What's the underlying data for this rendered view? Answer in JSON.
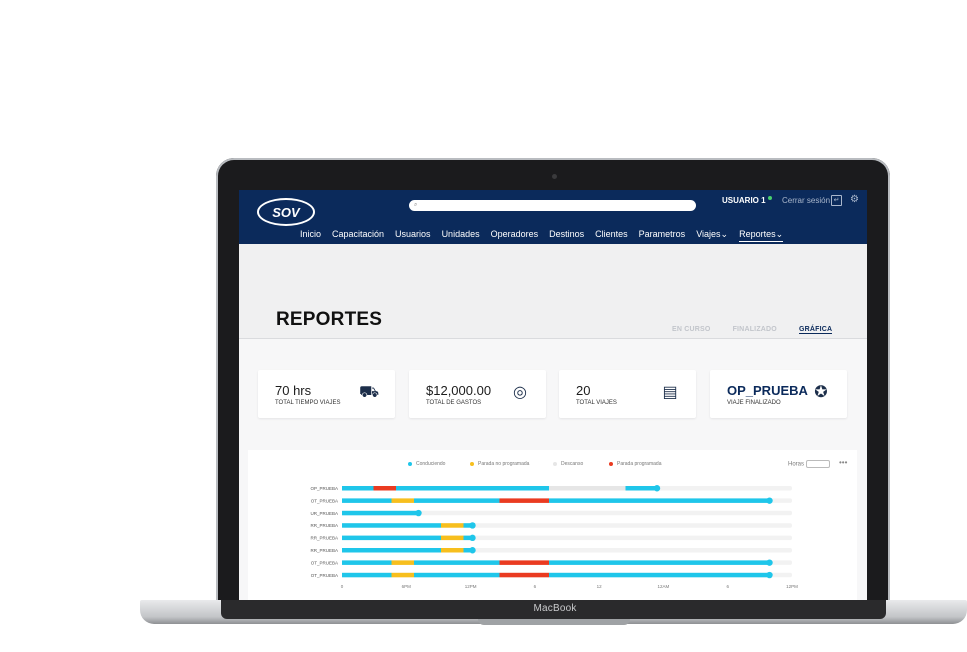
{
  "laptop": {
    "brand": "MacBook"
  },
  "header": {
    "logo": "SOV",
    "search_placeholder": "",
    "user": "USUARIO 1",
    "logout": "Cerrar sesión",
    "nav": [
      "Inicio",
      "Capacitación",
      "Usuarios",
      "Unidades",
      "Operadores",
      "Destinos",
      "Clientes",
      "Parametros",
      "Viajes⌄",
      "Reportes⌄"
    ],
    "active_nav": "Reportes"
  },
  "page": {
    "title": "REPORTES",
    "tabs": [
      "EN CURSO",
      "FINALIZADO",
      "GRÁFICA"
    ],
    "active_tab": "GRÁFICA"
  },
  "cards": [
    {
      "value": "70 hrs",
      "label": "TOTAL TIEMPO VIAJES",
      "icon": "truck-clock-icon"
    },
    {
      "value": "$12,000.00",
      "label": "TOTAL DE GASTOS",
      "icon": "coins-icon"
    },
    {
      "value": "20",
      "label": "TOTAL VIAJES",
      "icon": "document-list-icon"
    },
    {
      "value": "OP_PRUEBA",
      "label": "VIAJE FINALIZADO",
      "icon": "badge-icon"
    }
  ],
  "legend": [
    {
      "label": "Conduciendo",
      "color": "#1fc6ea"
    },
    {
      "label": "Parada no programada",
      "color": "#f7bf1e"
    },
    {
      "label": "Descanso",
      "color": "#e6e6e6"
    },
    {
      "label": "Parada programada",
      "color": "#ea3b21"
    }
  ],
  "controls": {
    "horas": "Horas",
    "more": "•••"
  },
  "chart_data": {
    "type": "timeline",
    "x_ticks": [
      "0",
      "6PM",
      "12PM",
      "6",
      "12",
      "12AM",
      "6",
      "12PM"
    ],
    "rows": [
      {
        "label": "OP_PRUEBA",
        "segments": [
          [
            "Conduciendo",
            0,
            0.7
          ],
          [
            "Parada programada",
            0.7,
            1.2
          ],
          [
            "Conduciendo",
            1.2,
            4.6
          ],
          [
            "Descanso",
            4.6,
            6.3
          ],
          [
            "Conduciendo",
            6.3,
            7.0
          ]
        ],
        "end": 7.0
      },
      {
        "label": "OT_PRUEBA",
        "segments": [
          [
            "Conduciendo",
            0,
            1.1
          ],
          [
            "Parada no programada",
            1.1,
            1.6
          ],
          [
            "Conduciendo",
            1.6,
            3.5
          ],
          [
            "Parada programada",
            3.5,
            4.6
          ],
          [
            "Conduciendo",
            4.6,
            9.5
          ]
        ],
        "end": 9.5
      },
      {
        "label": "UR_PRUEBA",
        "segments": [
          [
            "Conduciendo",
            0,
            1.7
          ]
        ],
        "end": 1.7
      },
      {
        "label": "RR_PRUEBA",
        "segments": [
          [
            "Conduciendo",
            0,
            2.2
          ],
          [
            "Parada no programada",
            2.2,
            2.7
          ],
          [
            "Conduciendo",
            2.7,
            2.9
          ]
        ],
        "end": 2.9
      },
      {
        "label": "RR_PRUEBA",
        "segments": [
          [
            "Conduciendo",
            0,
            2.2
          ],
          [
            "Parada no programada",
            2.2,
            2.7
          ],
          [
            "Conduciendo",
            2.7,
            2.9
          ]
        ],
        "end": 2.9
      },
      {
        "label": "RR_PRUEBA",
        "segments": [
          [
            "Conduciendo",
            0,
            2.2
          ],
          [
            "Parada no programada",
            2.2,
            2.7
          ],
          [
            "Conduciendo",
            2.7,
            2.9
          ]
        ],
        "end": 2.9
      },
      {
        "label": "OT_PRUEBA",
        "segments": [
          [
            "Conduciendo",
            0,
            1.1
          ],
          [
            "Parada no programada",
            1.1,
            1.6
          ],
          [
            "Conduciendo",
            1.6,
            3.5
          ],
          [
            "Parada programada",
            3.5,
            4.6
          ],
          [
            "Conduciendo",
            4.6,
            9.5
          ]
        ],
        "end": 9.5
      },
      {
        "label": "OT_PRUEBA",
        "segments": [
          [
            "Conduciendo",
            0,
            1.1
          ],
          [
            "Parada no programada",
            1.1,
            1.6
          ],
          [
            "Conduciendo",
            1.6,
            3.5
          ],
          [
            "Parada programada",
            3.5,
            4.6
          ],
          [
            "Conduciendo",
            4.6,
            9.5
          ]
        ],
        "end": 9.5
      }
    ],
    "x_range": [
      0,
      10
    ]
  }
}
